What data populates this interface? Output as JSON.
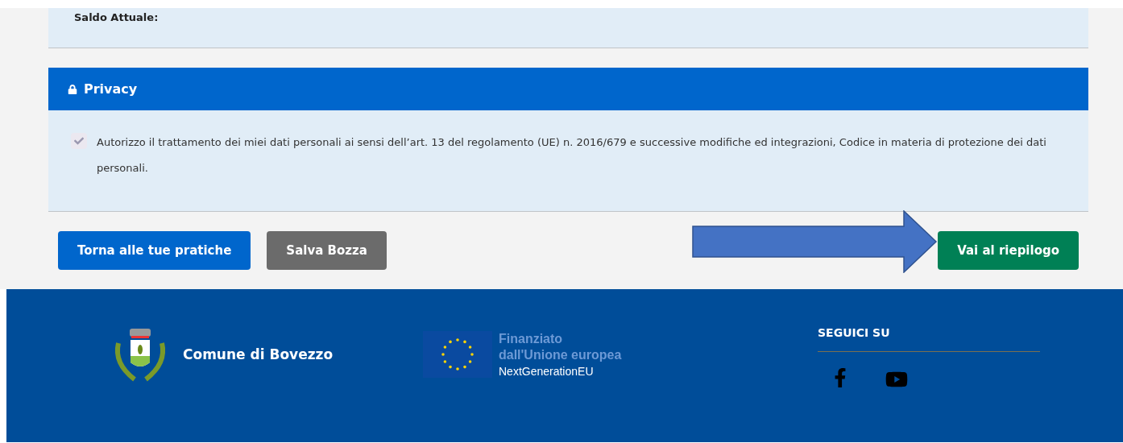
{
  "previous_section": {
    "label": "Saldo Attuale:"
  },
  "privacy": {
    "title": "Privacy",
    "consent": {
      "text": "Autorizzo il trattamento dei miei dati personali ai sensi dell’art. 13 del regolamento (UE) n. 2016/679 e successive modifiche ed integrazioni, Codice in materia di protezione dei dati personali.",
      "checked": true,
      "disabled": true
    }
  },
  "actions": {
    "left": [
      {
        "label": "Torna alle tue pratiche",
        "kind": "primary"
      },
      {
        "label": "Salva Bozza",
        "kind": "secondary"
      }
    ],
    "right": {
      "label": "Vai al riepilogo",
      "kind": "success"
    }
  },
  "footer": {
    "municipality": "Comune di Bovezzo",
    "eu_funding": {
      "line_1": "Finanziato",
      "line_2": "dall'Unione europea",
      "line_3": "NextGenerationEU"
    },
    "social": {
      "title": "SEGUICI SU",
      "links": [
        {
          "kind": "facebook"
        },
        {
          "kind": "youtube"
        }
      ]
    }
  }
}
